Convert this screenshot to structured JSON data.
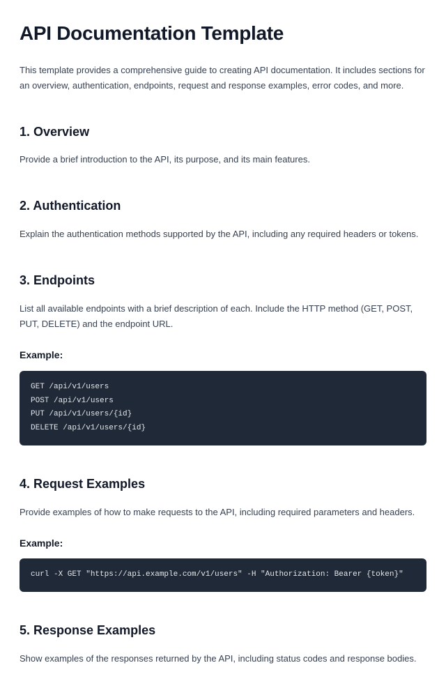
{
  "title": "API Documentation Template",
  "intro": "This template provides a comprehensive guide to creating API documentation. It includes sections for an overview, authentication, endpoints, request and response examples, error codes, and more.",
  "sections": {
    "overview": {
      "heading": "1. Overview",
      "body": "Provide a brief introduction to the API, its purpose, and its main features."
    },
    "auth": {
      "heading": "2. Authentication",
      "body": "Explain the authentication methods supported by the API, including any required headers or tokens."
    },
    "endpoints": {
      "heading": "3. Endpoints",
      "body": "List all available endpoints with a brief description of each. Include the HTTP method (GET, POST, PUT, DELETE) and the endpoint URL.",
      "example_label": "Example:",
      "code": "GET /api/v1/users\nPOST /api/v1/users\nPUT /api/v1/users/{id}\nDELETE /api/v1/users/{id}"
    },
    "request": {
      "heading": "4. Request Examples",
      "body": "Provide examples of how to make requests to the API, including required parameters and headers.",
      "example_label": "Example:",
      "code": "curl -X GET \"https://api.example.com/v1/users\" -H \"Authorization: Bearer {token}\""
    },
    "response": {
      "heading": "5. Response Examples",
      "body": "Show examples of the responses returned by the API, including status codes and response bodies."
    }
  }
}
